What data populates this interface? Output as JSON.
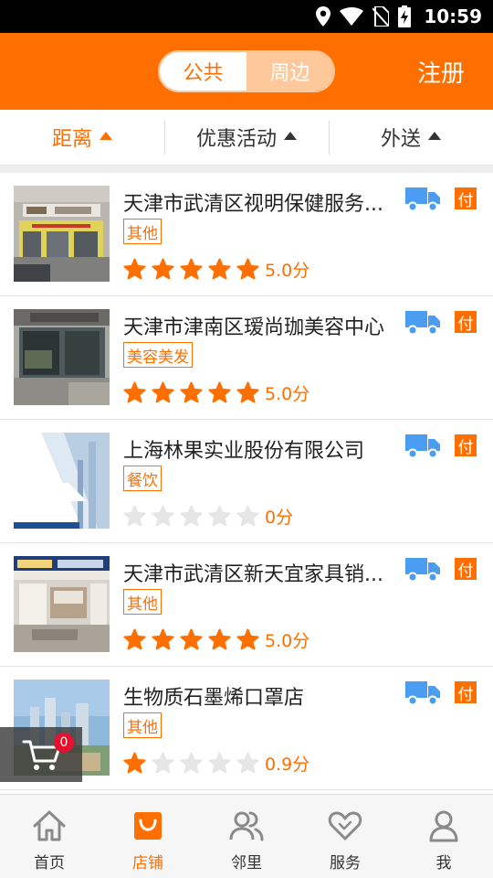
{
  "status_bar": {
    "time": "10:59"
  },
  "header": {
    "segments": [
      {
        "label": "公共",
        "active": true
      },
      {
        "label": "周边",
        "active": false
      }
    ],
    "register_label": "注册"
  },
  "filters": [
    {
      "label": "距离",
      "active": true
    },
    {
      "label": "优惠活动",
      "active": false
    },
    {
      "label": "外送",
      "active": false
    }
  ],
  "shops": [
    {
      "name": "天津市武清区视明保健服务...",
      "tag": "其他",
      "rating": 5,
      "score": "5.0分",
      "pay": "付"
    },
    {
      "name": "天津市津南区瑷尚珈美容中心",
      "tag": "美容美发",
      "rating": 5,
      "score": "5.0分",
      "pay": "付"
    },
    {
      "name": "上海林果实业股份有限公司",
      "tag": "餐饮",
      "rating": 0,
      "score": "0分",
      "pay": "付"
    },
    {
      "name": "天津市武清区新天宜家具销...",
      "tag": "其他",
      "rating": 5,
      "score": "5.0分",
      "pay": "付"
    },
    {
      "name": "生物质石墨烯口罩店",
      "tag": "其他",
      "rating": 1,
      "score": "0.9分",
      "pay": "付"
    }
  ],
  "cart": {
    "count": "0"
  },
  "tabs": [
    {
      "label": "首页",
      "icon": "home-icon",
      "active": false
    },
    {
      "label": "店铺",
      "icon": "shop-bag-icon",
      "active": true
    },
    {
      "label": "邻里",
      "icon": "neighbors-icon",
      "active": false
    },
    {
      "label": "服务",
      "icon": "heart-icon",
      "active": false
    },
    {
      "label": "我",
      "icon": "person-icon",
      "active": false
    }
  ],
  "colors": {
    "accent": "#ff6f00",
    "truck": "#4a9df0",
    "star_empty": "#e6e6e6"
  }
}
